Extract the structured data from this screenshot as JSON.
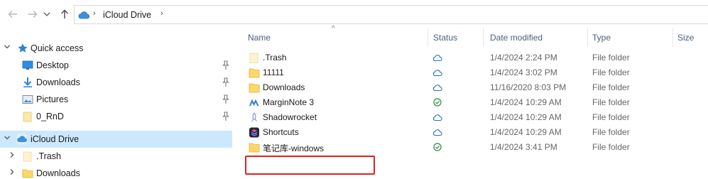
{
  "colors": {
    "selected_bg": "#cce8ff",
    "folder": "#ffd766",
    "cloud_status": "#1f6fc4",
    "synced_status": "#2a8a3a",
    "highlight_border": "#e0201f"
  },
  "nav": {
    "back_icon": "arrow-left-icon",
    "forward_icon": "arrow-right-icon",
    "recent_icon": "chevron-down-icon",
    "up_icon": "arrow-up-icon"
  },
  "address": {
    "location_label": "iCloud Drive",
    "separator": "›",
    "chevron": "›"
  },
  "sidebar": {
    "items": [
      {
        "label": "Quick access",
        "icon": "star-icon",
        "expanded": true
      },
      {
        "label": "Desktop",
        "icon": "desktop-icon",
        "pinned": true
      },
      {
        "label": "Downloads",
        "icon": "download-arrow-icon",
        "pinned": true
      },
      {
        "label": "Pictures",
        "icon": "pictures-icon",
        "pinned": true
      },
      {
        "label": "0_RnD",
        "icon": "folder-icon",
        "pinned": true
      },
      {
        "label": "iCloud Drive",
        "icon": "cloud-icon",
        "expanded": true,
        "selected": true
      },
      {
        "label": ".Trash",
        "icon": "folder-icon",
        "expanded": false
      },
      {
        "label": "Downloads",
        "icon": "folder-icon",
        "expanded": false
      }
    ]
  },
  "columns": {
    "name": "Name",
    "status": "Status",
    "date": "Date modified",
    "type": "Type",
    "size": "Size",
    "sort_indicator": "^"
  },
  "files": [
    {
      "name": ".Trash",
      "icon": "folder-light-icon",
      "status": "cloud-icon",
      "date": "1/4/2024 2:24 PM",
      "type": "File folder"
    },
    {
      "name": "11111",
      "icon": "folder-icon",
      "status": "cloud-icon",
      "date": "1/4/2024 3:02 PM",
      "type": "File folder"
    },
    {
      "name": "Downloads",
      "icon": "folder-icon",
      "status": "cloud-icon",
      "date": "11/16/2020 8:03 PM",
      "type": "File folder"
    },
    {
      "name": "MarginNote 3",
      "icon": "marginnote-icon",
      "status": "synced-check-icon",
      "date": "1/4/2024 10:29 AM",
      "type": "File folder"
    },
    {
      "name": "Shadowrocket",
      "icon": "shadowrocket-icon",
      "status": "cloud-icon",
      "date": "1/4/2024 10:29 AM",
      "type": "File folder"
    },
    {
      "name": "Shortcuts",
      "icon": "shortcuts-icon",
      "status": "cloud-icon",
      "date": "1/4/2024 10:29 AM",
      "type": "File folder"
    },
    {
      "name": "笔记库-windows",
      "icon": "folder-icon",
      "status": "synced-check-icon",
      "date": "1/4/2024 3:41 PM",
      "type": "File folder"
    }
  ]
}
